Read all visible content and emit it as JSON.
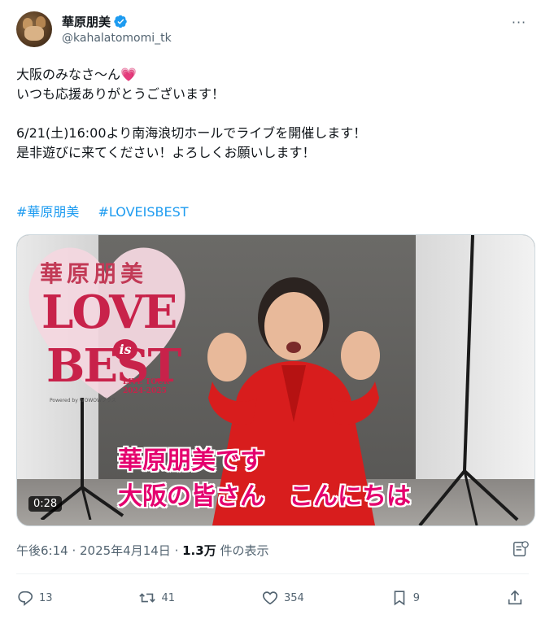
{
  "user": {
    "display_name": "華原朋美",
    "handle": "@kahalatomomi_tk",
    "verified": true,
    "avatar_icon": "avatar-dogs"
  },
  "post": {
    "text": "大阪のみなさ～ん",
    "text_emoji": "💗",
    "text_rest": "いつも応援ありがとうございます！\n\n6/21(土)16:00より南海浪切ホールでライブを開催します！\n是非遊びに来てください！よろしくお願いします！",
    "hashtags": [
      "#華原朋美",
      "#LOVEISBEST"
    ]
  },
  "media": {
    "logo_title": "華原朋美",
    "logo_love": "LOVE",
    "logo_is": "is",
    "logo_best": "BEST",
    "logo_tour": "LIVE TOUR\n2024-2025",
    "logo_powered": "Powered by WOWOWプラス",
    "caption_line1": "華原朋美です",
    "caption_line2": "大阪の皆さん　こんにちは",
    "duration": "0:28"
  },
  "meta": {
    "time": "午後6:14",
    "date": "2025年4月14日",
    "views_count": "1.3万",
    "views_label": "件の表示"
  },
  "actions": {
    "replies": "13",
    "reposts": "41",
    "likes": "354",
    "bookmarks": "9"
  },
  "colors": {
    "accent": "#1d9bf0",
    "caption": "#e4006e",
    "logo": "#c8224a"
  }
}
